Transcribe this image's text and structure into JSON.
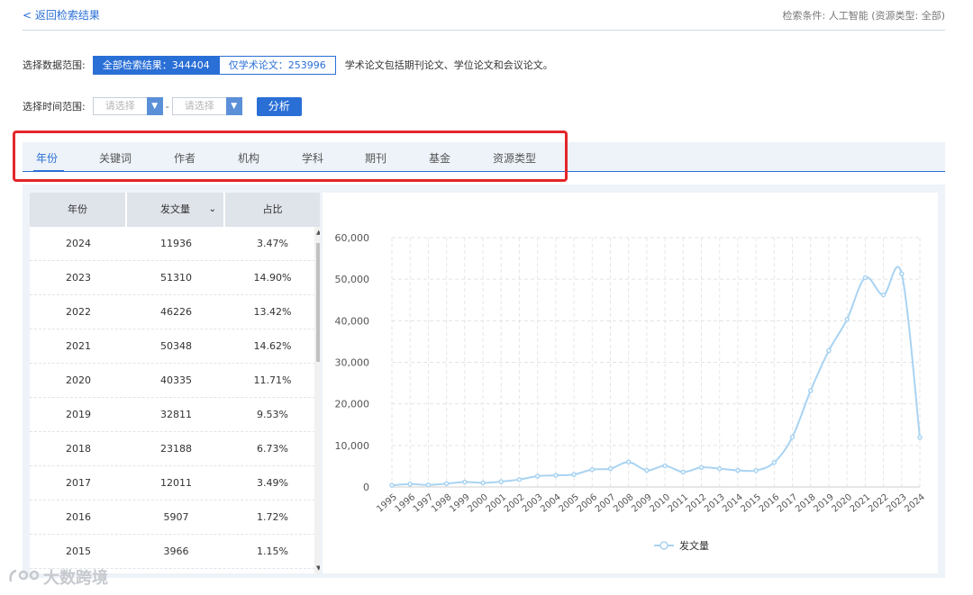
{
  "header": {
    "back_label": "< 返回检索结果",
    "search_condition": "检索条件: 人工智能 (资源类型: 全部)"
  },
  "range": {
    "label": "选择数据范围:",
    "all_results": "全部检索结果：344404",
    "academic_only": "仅学术论文：253996",
    "note": "学术论文包括期刊论文、学位论文和会议论文。"
  },
  "time": {
    "label": "选择时间范围:",
    "placeholder_start": "请选择",
    "placeholder_end": "请选择",
    "separator": "-",
    "analyze_label": "分析"
  },
  "tabs": [
    {
      "label": "年份"
    },
    {
      "label": "关键词"
    },
    {
      "label": "作者"
    },
    {
      "label": "机构"
    },
    {
      "label": "学科"
    },
    {
      "label": "期刊"
    },
    {
      "label": "基金"
    },
    {
      "label": "资源类型"
    }
  ],
  "table": {
    "headers": [
      "年份",
      "发文量",
      "占比"
    ],
    "rows": [
      [
        "2024",
        "11936",
        "3.47%"
      ],
      [
        "2023",
        "51310",
        "14.90%"
      ],
      [
        "2022",
        "46226",
        "13.42%"
      ],
      [
        "2021",
        "50348",
        "14.62%"
      ],
      [
        "2020",
        "40335",
        "11.71%"
      ],
      [
        "2019",
        "32811",
        "9.53%"
      ],
      [
        "2018",
        "23188",
        "6.73%"
      ],
      [
        "2017",
        "12011",
        "3.49%"
      ],
      [
        "2016",
        "5907",
        "1.72%"
      ],
      [
        "2015",
        "3966",
        "1.15%"
      ]
    ]
  },
  "chart_data": {
    "type": "line",
    "x": [
      "1995",
      "1996",
      "1997",
      "1998",
      "1999",
      "2000",
      "2001",
      "2002",
      "2003",
      "2004",
      "2005",
      "2006",
      "2007",
      "2008",
      "2009",
      "2010",
      "2011",
      "2012",
      "2013",
      "2014",
      "2015",
      "2016",
      "2017",
      "2018",
      "2019",
      "2020",
      "2021",
      "2022",
      "2023",
      "2024"
    ],
    "series": [
      {
        "name": "发文量",
        "values": [
          400,
          700,
          500,
          800,
          1200,
          1000,
          1300,
          1800,
          2600,
          2800,
          3000,
          4200,
          4400,
          6000,
          4000,
          5100,
          3600,
          4700,
          4400,
          4000,
          3966,
          5907,
          12011,
          23188,
          32811,
          40335,
          50348,
          46226,
          51310,
          11936
        ]
      }
    ],
    "ylim": [
      0,
      60000
    ],
    "yticks": [
      0,
      10000,
      20000,
      30000,
      40000,
      50000,
      60000
    ],
    "ytick_labels": [
      "0",
      "10,000",
      "20,000",
      "30,000",
      "40,000",
      "50,000",
      "60,000"
    ],
    "grid": true,
    "legend": "bottom-center",
    "color": "#a9d3f2"
  },
  "watermark": {
    "text": "大数跨境"
  }
}
